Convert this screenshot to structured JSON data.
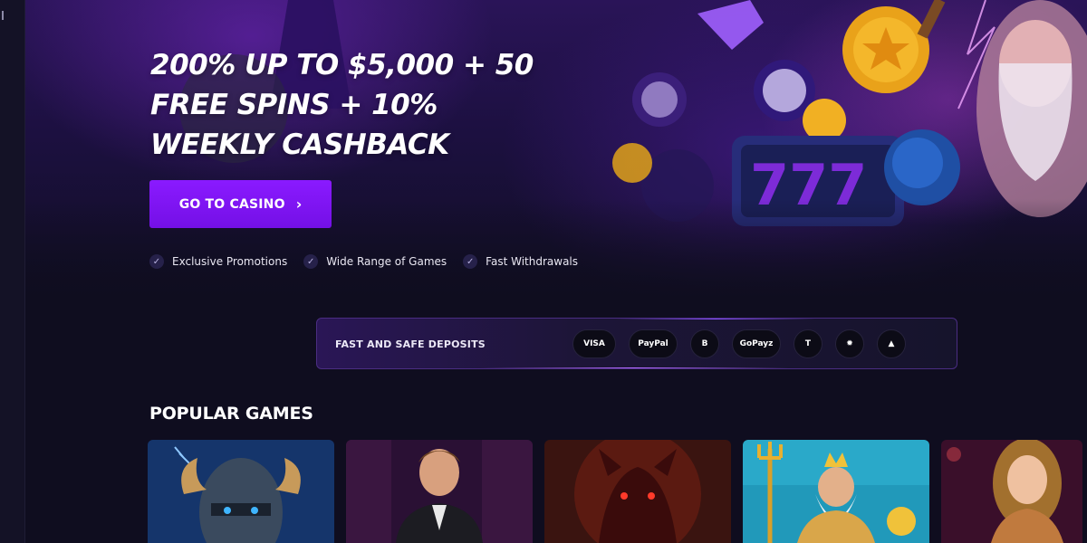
{
  "hero": {
    "headline_line1": "200% UP TO $5,000 + 50",
    "headline_line2": "FREE SPINS + 10%",
    "headline_line3": "WEEKLY CASHBACK",
    "cta_label": "GO TO CASINO",
    "features": [
      "Exclusive Promotions",
      "Wide Range of Games",
      "Fast Withdrawals"
    ]
  },
  "deposits": {
    "label": "FAST AND SAFE DEPOSITS",
    "methods": [
      "VISA",
      "PayPal",
      "B",
      "GoPayz",
      "T",
      "✹",
      "▲"
    ]
  },
  "games_section": {
    "title": "POPULAR GAMES"
  },
  "colors": {
    "accent": "#7f14f0",
    "background": "#0f0d1f"
  }
}
